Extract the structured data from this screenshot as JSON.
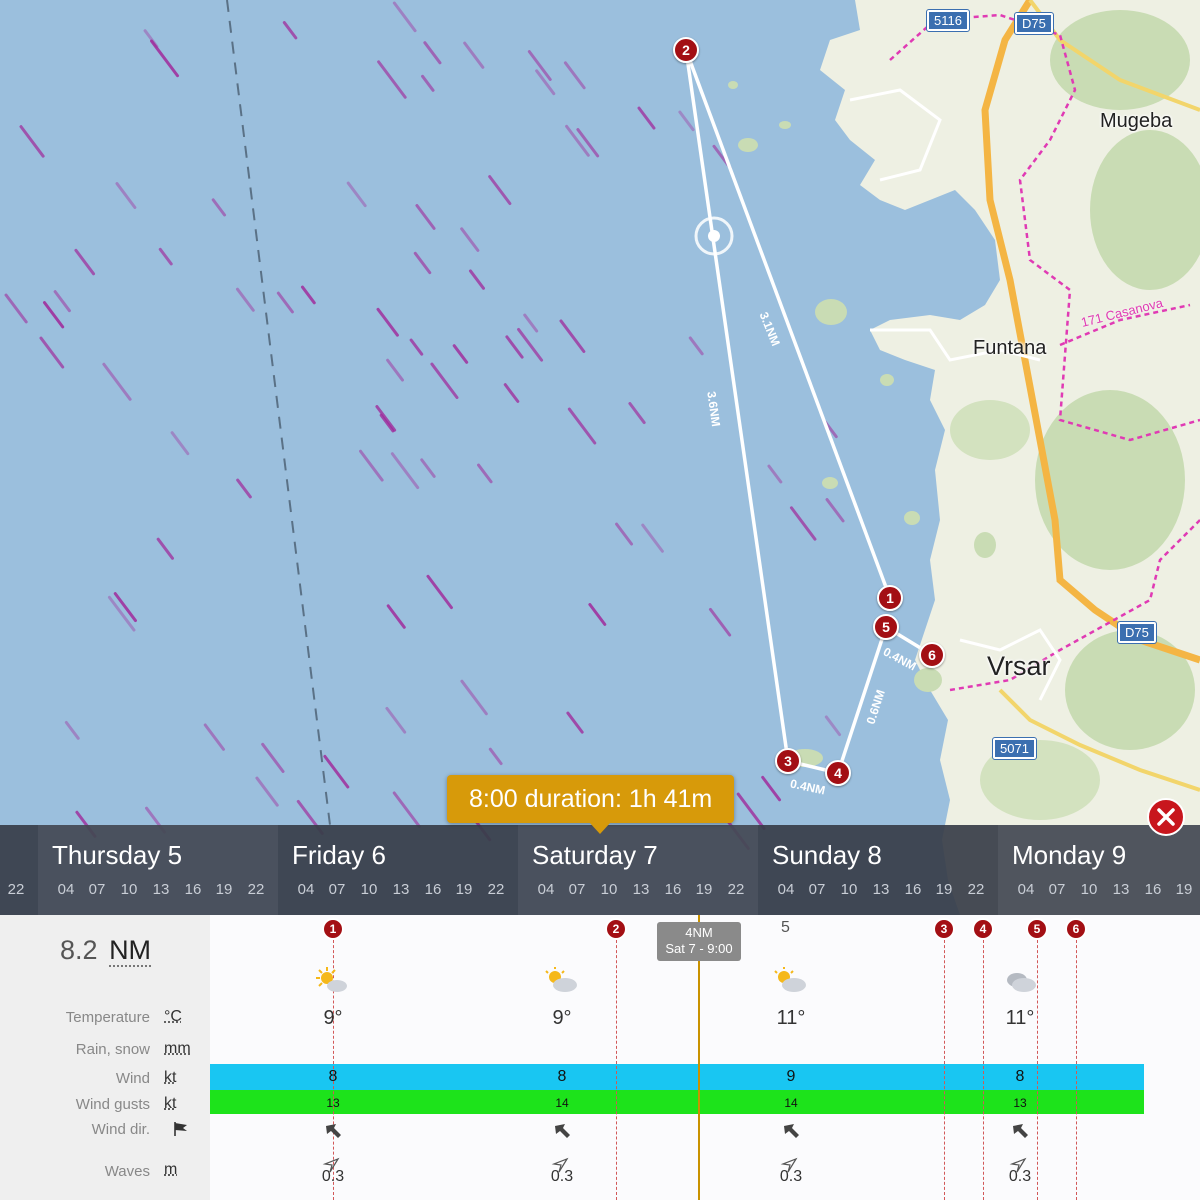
{
  "map": {
    "places": {
      "mugeba": "Mugeba",
      "funtana": "Funtana",
      "vrsar": "Vrsar"
    },
    "roads": {
      "r5116": "5116",
      "d75_top": "D75",
      "d75_mid": "D75",
      "r5071": "5071"
    },
    "trail": "171 Casanova",
    "waypoints": [
      "1",
      "2",
      "3",
      "4",
      "5",
      "6"
    ],
    "legs": [
      "3.1NM",
      "3.6NM",
      "0.4NM",
      "0.6NM",
      "0.4NM"
    ],
    "colors": {
      "sea": "#9bbfdd",
      "land": "#eef0e3",
      "route": "#ffffff",
      "waypoint": "#a30f14",
      "wind_particle": "#a0279a"
    }
  },
  "tooltip": {
    "text": "8:00 duration: 1h 41m"
  },
  "close_button": {
    "icon": "close-icon"
  },
  "timeline": {
    "days": [
      {
        "name": "",
        "hours": [
          "22"
        ]
      },
      {
        "name": "Thursday 5",
        "hours": [
          "04",
          "07",
          "10",
          "13",
          "16",
          "19",
          "22"
        ]
      },
      {
        "name": "Friday 6",
        "hours": [
          "04",
          "07",
          "10",
          "13",
          "16",
          "19",
          "22"
        ]
      },
      {
        "name": "Saturday 7",
        "hours": [
          "04",
          "07",
          "10",
          "13",
          "16",
          "19",
          "22"
        ]
      },
      {
        "name": "Sunday 8",
        "hours": [
          "04",
          "07",
          "10",
          "13",
          "16",
          "19",
          "22"
        ]
      },
      {
        "name": "Monday 9",
        "hours": [
          "04",
          "07",
          "10",
          "13",
          "16",
          "19"
        ]
      }
    ]
  },
  "panel": {
    "distance": {
      "value": "8.2",
      "unit": "NM"
    },
    "rows": {
      "temperature": {
        "label": "Temperature",
        "unit": "°C"
      },
      "rain": {
        "label": "Rain, snow",
        "unit": "mm"
      },
      "wind": {
        "label": "Wind",
        "unit": "kt"
      },
      "gusts": {
        "label": "Wind gusts",
        "unit": "kt"
      },
      "direction": {
        "label": "Wind dir.",
        "unit": "flag-icon"
      },
      "waves": {
        "label": "Waves",
        "unit": "m"
      }
    },
    "now_marker": {
      "distance": "4NM",
      "time": "Sat 7 - 9:00"
    },
    "extra_tick": "5",
    "forecast": [
      {
        "icon": "sun-cloud-icon",
        "temp": "9°",
        "wind": "8",
        "gusts": "13",
        "wave": "0.3"
      },
      {
        "icon": "cloud-sun-icon",
        "temp": "9°",
        "wind": "8",
        "gusts": "14",
        "wave": "0.3"
      },
      {
        "icon": "cloud-sun-icon",
        "temp": "11°",
        "wind": "9",
        "gusts": "14",
        "wave": "0.3"
      },
      {
        "icon": "cloud-icon",
        "temp": "11°",
        "wind": "8",
        "gusts": "13",
        "wave": "0.3"
      }
    ],
    "colors": {
      "wind_bar": "#19c6f2",
      "gust_bar": "#1de31b",
      "now_line": "#c99200"
    }
  }
}
